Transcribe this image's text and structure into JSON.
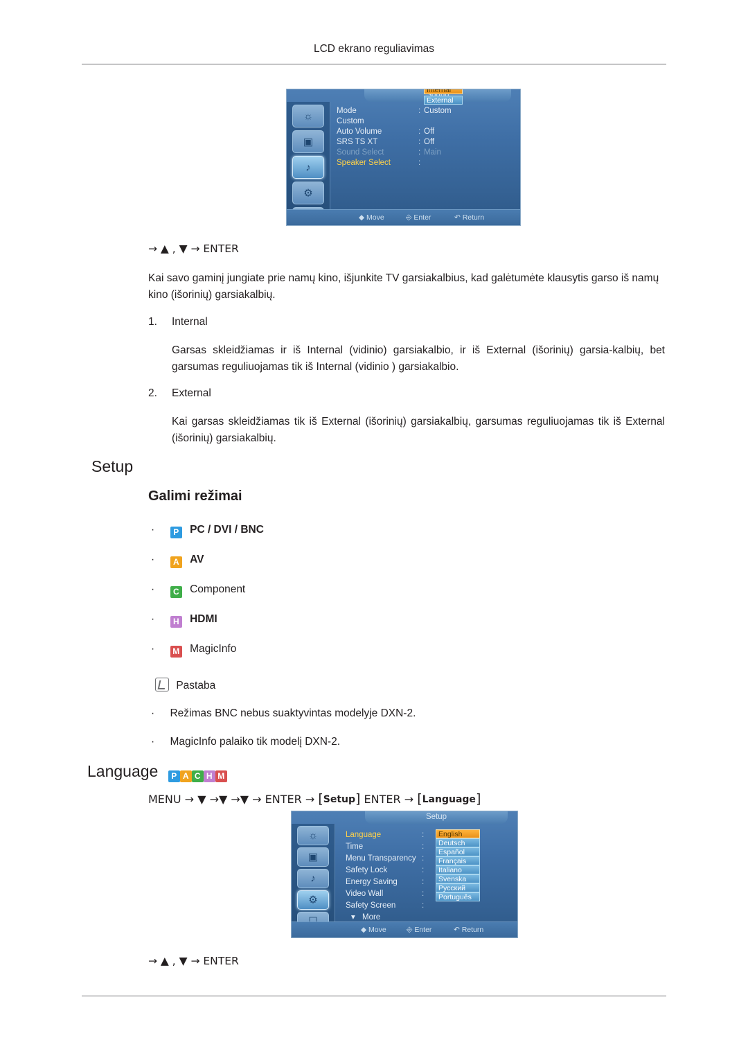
{
  "header": {
    "running_title": "LCD ekrano reguliavimas"
  },
  "osd_sound": {
    "title": "Sound",
    "icons": [
      "picture-icon",
      "display-icon",
      "sound-icon",
      "setup-icon",
      "multi-control-icon"
    ],
    "selected_icon_index": 2,
    "rows": [
      {
        "label": "Mode",
        "value": "Custom",
        "state": "normal"
      },
      {
        "label": "Custom",
        "value": "",
        "state": "normal"
      },
      {
        "label": "Auto Volume",
        "value": "Off",
        "state": "normal"
      },
      {
        "label": "SRS TS XT",
        "value": "Off",
        "state": "normal"
      },
      {
        "label": "Sound Select",
        "value": "Main",
        "state": "dim"
      },
      {
        "label": "Speaker Select",
        "value": "",
        "state": "highlight"
      }
    ],
    "chips": [
      {
        "label": "Internal",
        "selected": true
      },
      {
        "label": "External",
        "selected": false
      }
    ],
    "footer": {
      "move": "Move",
      "enter": "Enter",
      "return": "Return"
    }
  },
  "osd_setup": {
    "title": "Setup",
    "icons": [
      "picture-icon",
      "display-icon",
      "sound-icon",
      "setup-icon",
      "multi-control-icon"
    ],
    "selected_icon_index": 3,
    "rows": [
      {
        "label": "Language",
        "state": "highlight"
      },
      {
        "label": "Time",
        "state": "normal"
      },
      {
        "label": "Menu Transparency",
        "state": "normal"
      },
      {
        "label": "Safety Lock",
        "state": "normal"
      },
      {
        "label": "Energy Saving",
        "state": "normal"
      },
      {
        "label": "Video Wall",
        "state": "normal"
      },
      {
        "label": "Safety Screen",
        "state": "normal"
      },
      {
        "label": "More",
        "state": "more"
      }
    ],
    "languages": [
      {
        "label": "English",
        "selected": true
      },
      {
        "label": "Deutsch",
        "selected": false
      },
      {
        "label": "Español",
        "selected": false
      },
      {
        "label": "Français",
        "selected": false
      },
      {
        "label": "Italiano",
        "selected": false
      },
      {
        "label": "Svenska",
        "selected": false
      },
      {
        "label": "Русский",
        "selected": false
      },
      {
        "label": "Português",
        "selected": false
      }
    ],
    "footer": {
      "move": "Move",
      "enter": "Enter",
      "return": "Return"
    }
  },
  "body": {
    "nav_sound": "→ ▲ , ▼ → ENTER",
    "para_home_theater": "Kai savo gaminį jungiate prie namų kino, išjunkite TV garsiakalbius, kad galėtumėte klausytis garso iš namų kino (išorinių) garsiakalbių.",
    "item1_number": "1.",
    "item1_title": "Internal",
    "item1_text": "Garsas skleidžiamas ir iš Internal (vidinio) garsiakalbio, ir iš External (išorinių) garsia-kalbių, bet garsumas reguliuojamas tik iš Internal (vidinio ) garsiakalbio.",
    "item2_number": "2.",
    "item2_title": "External",
    "item2_text": "Kai garsas skleidžiamas tik iš External (išorinių) garsiakalbių, garsumas reguliuojamas tik iš External (išorinių) garsiakalbių.",
    "setup_heading": "Setup",
    "galimi_heading": "Galimi režimai",
    "modes": [
      {
        "badge": "P",
        "badge_class": "p",
        "label": "PC / DVI / BNC"
      },
      {
        "badge": "A",
        "badge_class": "a",
        "label": "AV"
      },
      {
        "badge": "C",
        "badge_class": "c",
        "label": "Component"
      },
      {
        "badge": "H",
        "badge_class": "h",
        "label": "HDMI"
      },
      {
        "badge": "M",
        "badge_class": "m",
        "label": "MagicInfo"
      }
    ],
    "note_label": "Pastaba",
    "notes": [
      "Režimas BNC nebus suaktyvintas modelyje DXN-2.",
      "MagicInfo palaiko tik modelį DXN-2."
    ],
    "language_heading": "Language",
    "language_badges": [
      "P",
      "A",
      "C",
      "H",
      "M"
    ],
    "menu_path_prefix": "MENU →",
    "menu_path_arrows": "▼ →▼ →▼ →",
    "menu_path_enter1": "ENTER →",
    "menu_path_setup": "Setup",
    "menu_path_enter2": "ENTER →",
    "menu_path_language": "Language",
    "nav_setup": "→ ▲ , ▼ → ENTER"
  }
}
